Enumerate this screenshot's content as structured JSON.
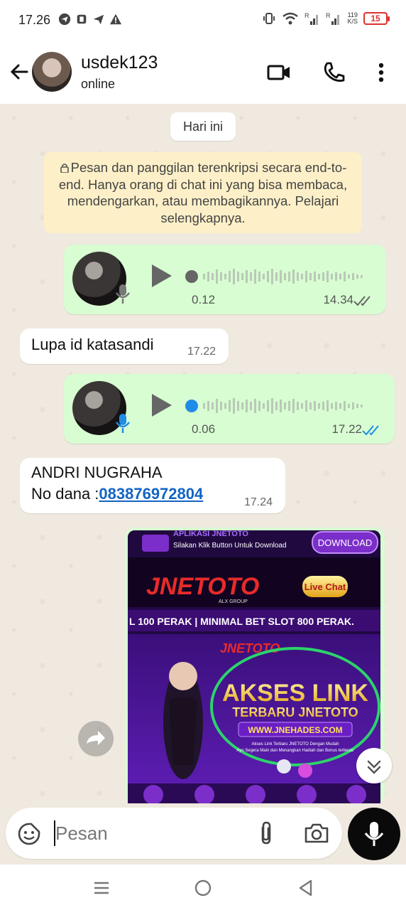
{
  "status_bar": {
    "time": "17.26",
    "net_speed_value": "119",
    "net_speed_unit": "K/S",
    "battery": "15"
  },
  "header": {
    "contact_name": "usdek123",
    "contact_status": "online"
  },
  "chat": {
    "day_chip": "Hari ini",
    "encryption_note": "Pesan dan panggilan terenkripsi secara end-to-end. Hanya orang di chat ini yang bisa membaca, mendengarkan, atau membagikannya. Pelajari selengkapnya.",
    "messages": [
      {
        "type": "voice",
        "direction": "out",
        "position": "0.12",
        "time": "14.34",
        "played": false
      },
      {
        "type": "text",
        "direction": "in",
        "text": "Lupa id katasandi",
        "time": "17.22"
      },
      {
        "type": "voice",
        "direction": "out",
        "position": "0.06",
        "time": "17.22",
        "played": true
      },
      {
        "type": "text",
        "direction": "in",
        "line1": "ANDRI NUGRAHA",
        "line2_prefix": "No dana :",
        "phone": "083876972804",
        "time": "17.24"
      },
      {
        "type": "image",
        "direction": "out"
      }
    ]
  },
  "image_content": {
    "top_title": "APLIKASI JNETOTO",
    "top_sub": "Silakan Klik Button Untuk Download",
    "download_label": "DOWNLOAD",
    "brand": "JNETOTO",
    "brand_sub": "ALX GROUP",
    "live_chat": "Live Chat",
    "ticker": "L 100 PERAK | MINIMAL BET SLOT 800 PERAK.",
    "promo_line1": "AKSES LINK",
    "promo_line2": "TERBARU JNETOTO",
    "promo_url": "WWW.JNEHADES.COM",
    "promo_small1": "Akses Link Terbaru JNETOTO Dengan Mudah",
    "promo_small2": "Ayo Segera Main dan Menangkan Hadiah dan Bonus terbesar"
  },
  "composer": {
    "placeholder": "Pesan"
  },
  "colors": {
    "outgoing_bubble": "#d8fdd2",
    "incoming_bubble": "#ffffff",
    "encryption_note_bg": "#fdf0c8",
    "played_tick": "#1f8de8",
    "phone_link": "#1264c4",
    "battery_low": "#e0312e"
  },
  "icons": [
    "back-arrow-icon",
    "video-call-icon",
    "voice-call-icon",
    "more-options-icon",
    "lock-icon",
    "play-icon",
    "mic-icon",
    "double-check-icon",
    "forward-icon",
    "scroll-down-icon",
    "emoji-sticker-icon",
    "attach-icon",
    "camera-icon",
    "nav-recents-icon",
    "nav-home-icon",
    "nav-back-icon"
  ]
}
